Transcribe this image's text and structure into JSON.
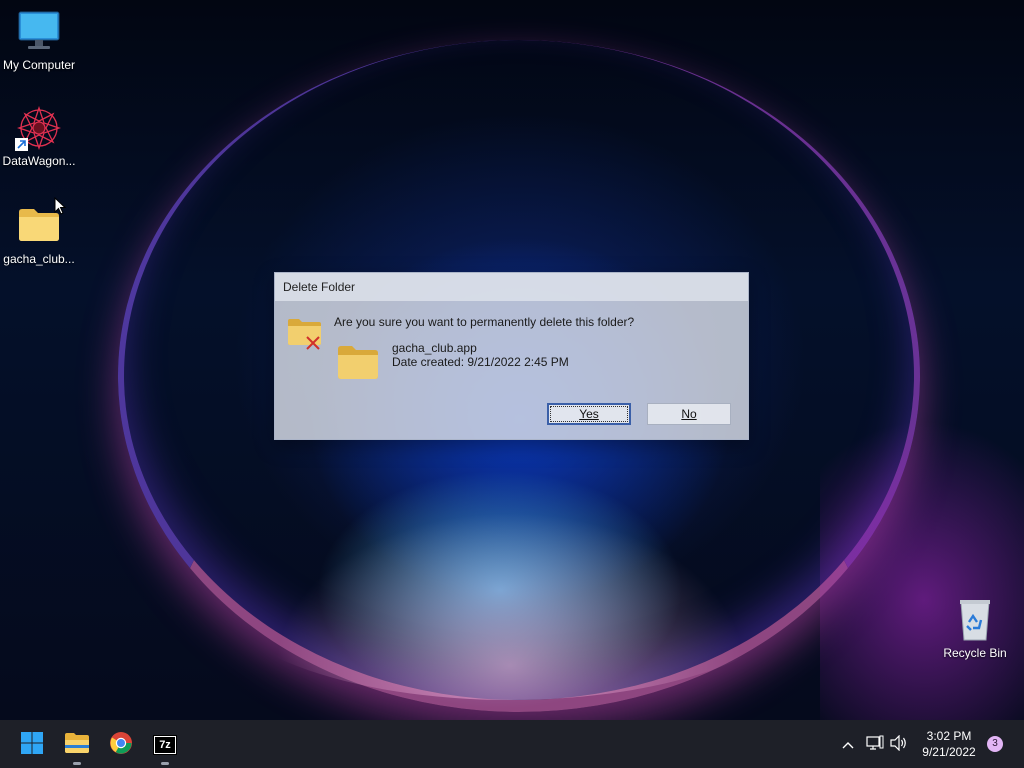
{
  "desktop": {
    "icons": [
      {
        "label": "My Computer"
      },
      {
        "label": "DataWagon..."
      },
      {
        "label": "gacha_club..."
      },
      {
        "label": "Recycle Bin"
      }
    ]
  },
  "dialog": {
    "title": "Delete Folder",
    "question": "Are you sure you want to permanently delete this folder?",
    "file_name": "gacha_club.app",
    "date_created": "Date created: 9/21/2022 2:45 PM",
    "yes_label": "Yes",
    "no_label": "No"
  },
  "taskbar": {
    "apps": [
      "start-icon",
      "file-explorer-icon",
      "chrome-icon",
      "7zip-icon"
    ],
    "sevenzip_text": "7z",
    "time": "3:02 PM",
    "date": "9/21/2022",
    "notification_count": "3"
  },
  "colors": {
    "taskbar": "#1e2028",
    "dialog_bg": "#d6dbe6",
    "default_button_border": "#3a5fa8",
    "folder_yellow": "#f7d36b",
    "start_blue": "#2fa6f5"
  }
}
